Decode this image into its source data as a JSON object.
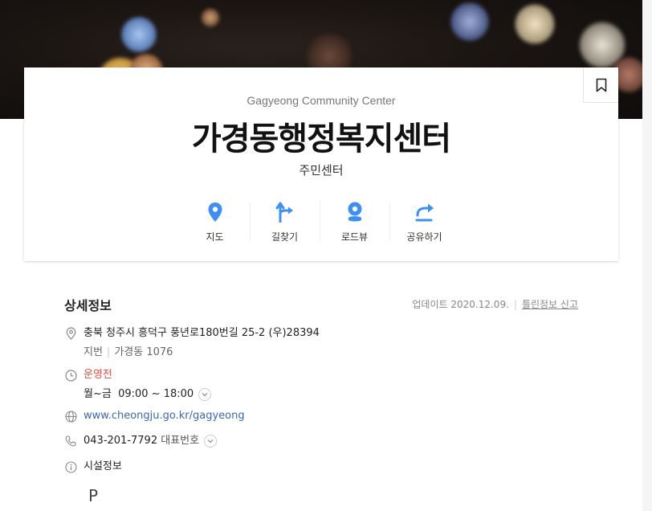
{
  "place": {
    "name_en": "Gagyeong Community Center",
    "name_ko": "가경동행정복지센터",
    "category": "주민센터"
  },
  "actions": [
    {
      "label": "지도",
      "icon": "map-pin-icon"
    },
    {
      "label": "길찾기",
      "icon": "directions-icon"
    },
    {
      "label": "로드뷰",
      "icon": "roadview-icon"
    },
    {
      "label": "공유하기",
      "icon": "share-icon"
    }
  ],
  "detail": {
    "title": "상세정보",
    "updated": "업데이트 2020.12.09.",
    "report_label": "틀린정보 신고",
    "address": "충북 청주시 흥덕구 풍년로180번길 25-2 (우)28394",
    "lot_label": "지번",
    "lot_value": "가경동 1076",
    "status": "운영전",
    "hours": "월~금  09:00 ~ 18:00",
    "website": "www.cheongju.go.kr/gagyeong",
    "phone": "043-201-7792",
    "phone_label": "대표번호",
    "facility_label": "시설정보",
    "parking_symbol": "P"
  },
  "colors": {
    "accent": "#3d8ff5",
    "status_red": "#e84a3f",
    "link": "#3b67b3"
  }
}
